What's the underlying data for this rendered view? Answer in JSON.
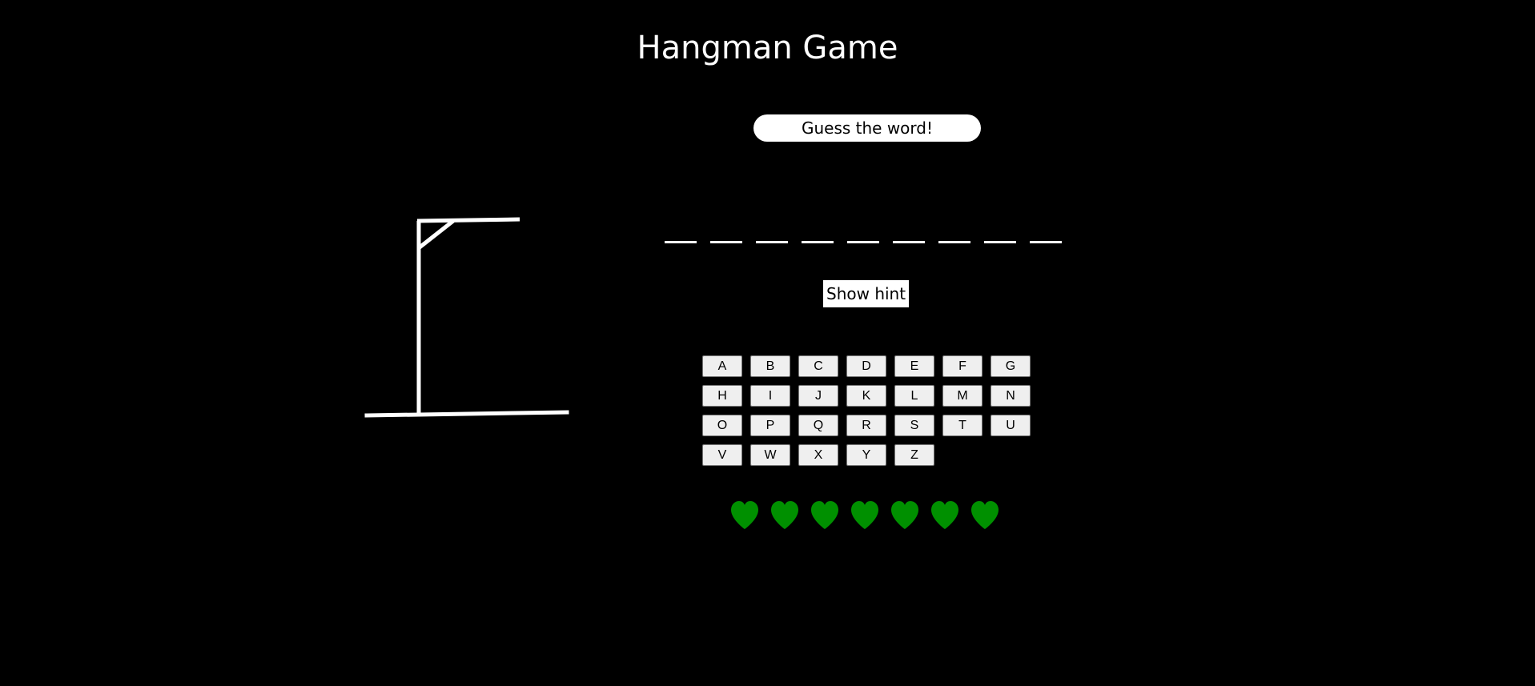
{
  "title": "Hangman Game",
  "status_message": "Guess the word!",
  "word": {
    "length": 9,
    "revealed": [
      "",
      "",
      "",
      "",
      "",
      "",
      "",
      "",
      ""
    ]
  },
  "hint_button_label": "Show hint",
  "keyboard": {
    "letters": [
      "A",
      "B",
      "C",
      "D",
      "E",
      "F",
      "G",
      "H",
      "I",
      "J",
      "K",
      "L",
      "M",
      "N",
      "O",
      "P",
      "Q",
      "R",
      "S",
      "T",
      "U",
      "V",
      "W",
      "X",
      "Y",
      "Z"
    ]
  },
  "lives": {
    "remaining": 7,
    "total": 7,
    "icon": "heart-icon",
    "color": "#009000"
  },
  "gallows": {
    "stage": 0,
    "icon": "gallows-icon",
    "color": "#ffffff"
  },
  "colors": {
    "background": "#000000",
    "text": "#ffffff",
    "key_background": "#efefef"
  }
}
